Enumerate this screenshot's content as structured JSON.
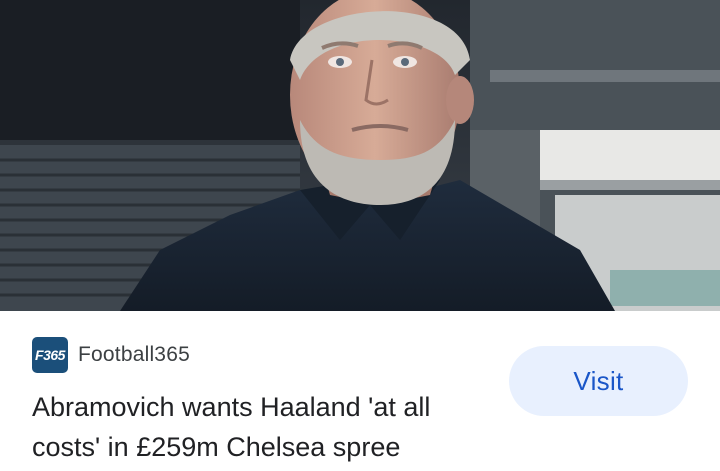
{
  "card": {
    "image": {
      "icon": "news-photo",
      "colors": {
        "suit": "#1d2a3a",
        "hair": "#c8c6c0",
        "skin": "#c99a85",
        "background": "#2a3038"
      }
    },
    "source": {
      "logo_text": "F365",
      "logo_color": "#1b4f7a",
      "name": "Football365"
    },
    "headline": "Abramovich wants Haaland 'at all costs' in £259m Chelsea spree",
    "visit_label": "Visit",
    "accent_color": "#1a56c8",
    "button_bg": "#e8f0fe"
  }
}
